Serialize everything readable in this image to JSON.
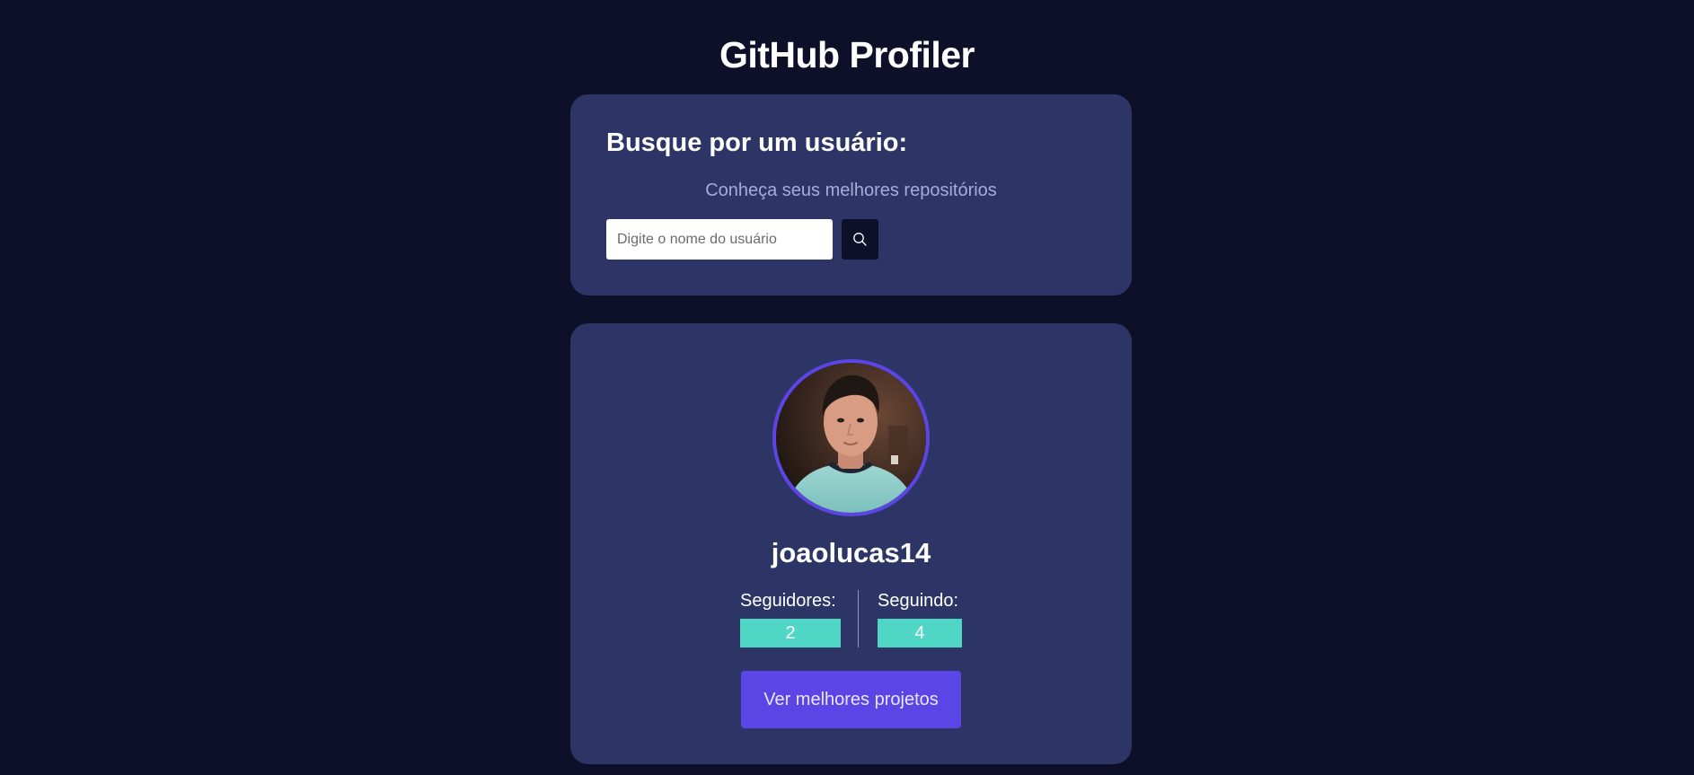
{
  "header": {
    "title": "GitHub Profiler"
  },
  "search": {
    "heading": "Busque por um usuário:",
    "subtitle": "Conheça seus melhores repositórios",
    "placeholder": "Digite o nome do usuário",
    "value": "",
    "button_icon": "search-icon"
  },
  "profile": {
    "avatar_icon": "avatar",
    "username": "joaolucas14",
    "followers_label": "Seguidores:",
    "followers_count": "2",
    "following_label": "Seguindo:",
    "following_count": "4",
    "projects_button_label": "Ver melhores projetos"
  },
  "colors": {
    "background": "#0e1029",
    "card": "#2d3567",
    "accent": "#5b46e5",
    "stat_badge": "#4fd6c5",
    "subtitle": "#a6abd9"
  }
}
